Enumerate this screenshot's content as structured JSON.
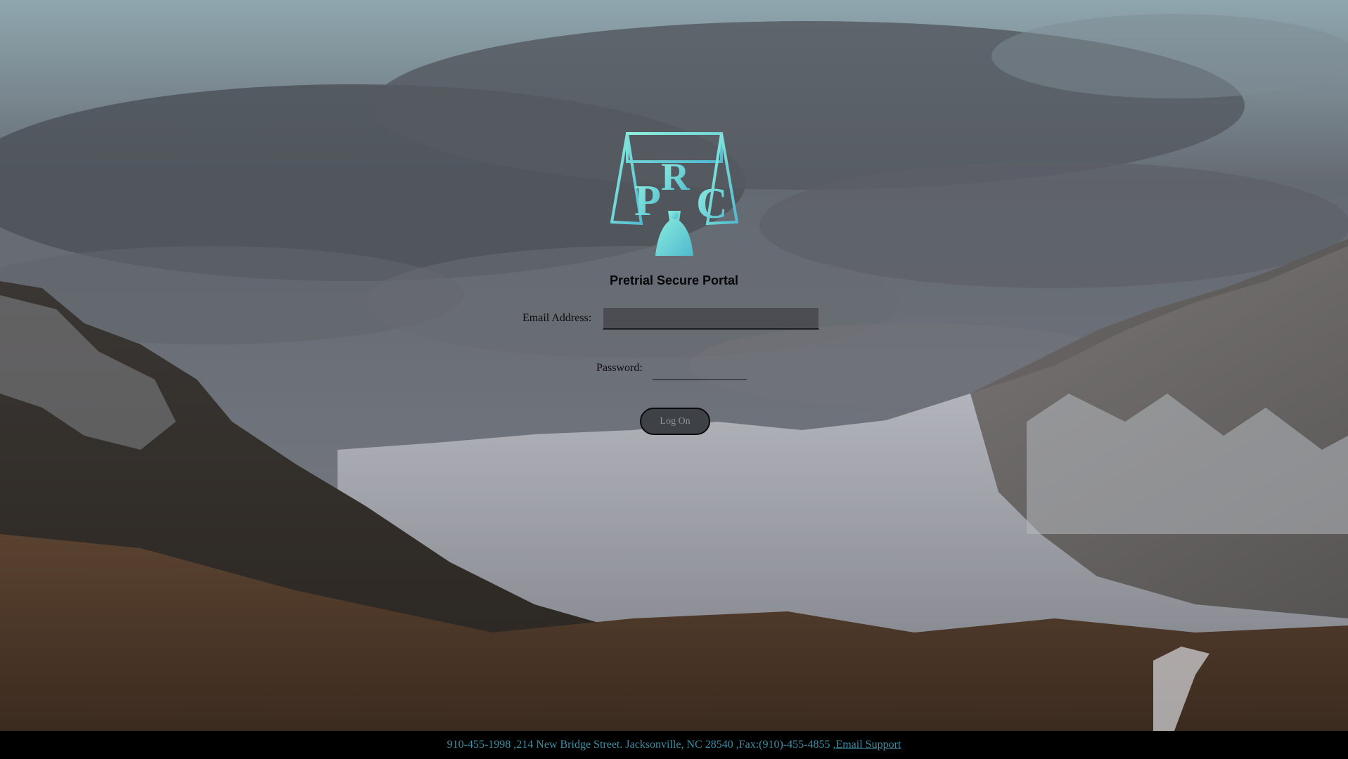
{
  "page": {
    "title": "Pretrial Secure Portal"
  },
  "logo": {
    "letters": [
      "P",
      "R",
      "C"
    ],
    "color": "#6ed6d2"
  },
  "form": {
    "email_label": "Email Address:",
    "email_value": "",
    "password_label": "Password:",
    "password_value": "",
    "submit_label": "Log On"
  },
  "footer": {
    "contact_text": "910-455-1998 ,214 New Bridge Street. Jacksonville, NC 28540 ,Fax:(910)-455-4855 ,",
    "support_link": "Email Support"
  },
  "colors": {
    "footer_text": "#3e8fa3",
    "footer_background": "#000000"
  }
}
